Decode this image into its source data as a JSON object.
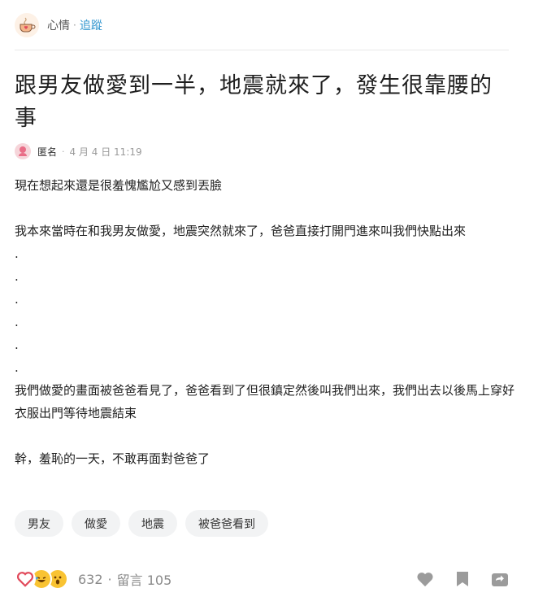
{
  "header": {
    "forum_name": "心情",
    "separator": "·",
    "follow_label": "追蹤"
  },
  "post": {
    "title": "跟男友做愛到一半，地震就來了，發生很靠腰的事",
    "author": "匿名",
    "meta_separator": "·",
    "time": "4 月 4 日 11:19",
    "paragraphs": [
      "現在想起來還是很羞愧尷尬又感到丟臉",
      "",
      "我本來當時在和我男友做愛，地震突然就來了，爸爸直接打開門進來叫我們快點出來",
      ".",
      ".",
      ".",
      ".",
      ".",
      ".",
      "我們做愛的畫面被爸爸看見了，爸爸看到了但很鎮定然後叫我們出來，我們出去以後馬上穿好衣服出門等待地震結束",
      "",
      "幹，羞恥的一天，不敢再面對爸爸了"
    ]
  },
  "tags": [
    "男友",
    "做愛",
    "地震",
    "被爸爸看到"
  ],
  "footer": {
    "reaction_count": "632",
    "separator": "·",
    "comment_label": "留言 105",
    "reaction_icons": [
      "heart-icon",
      "laugh-icon",
      "wow-icon"
    ]
  },
  "colors": {
    "accent": "#3397cf",
    "heart": "#e14a5b",
    "reaction_yellow": "#f9c332",
    "action_gray": "#9b9b9b"
  }
}
